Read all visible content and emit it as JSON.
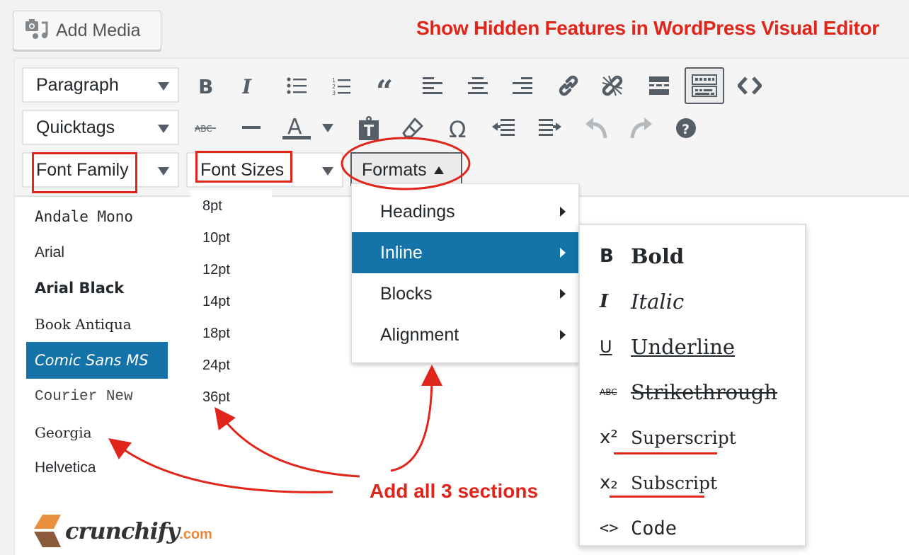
{
  "header": {
    "add_media_label": "Add Media",
    "headline": "Show Hidden Features in WordPress Visual Editor"
  },
  "toolbar": {
    "row1": {
      "select_label": "Paragraph",
      "icons": [
        "bold-icon",
        "italic-icon",
        "bullet-list-icon",
        "numbered-list-icon",
        "blockquote-icon",
        "align-left-icon",
        "align-center-icon",
        "align-right-icon",
        "link-icon",
        "unlink-icon",
        "read-more-icon",
        "toolbar-toggle-icon",
        "code-icon"
      ]
    },
    "row2": {
      "select_label": "Quicktags",
      "icons": [
        "strikethrough-icon",
        "horizontal-line-icon",
        "text-color-icon",
        "text-color-dropdown-icon",
        "paste-text-icon",
        "clear-formatting-icon",
        "special-character-icon",
        "outdent-icon",
        "indent-icon",
        "undo-icon",
        "redo-icon",
        "help-icon"
      ]
    },
    "row3": {
      "font_family_label": "Font Family",
      "font_sizes_label": "Font Sizes",
      "formats_label": "Formats"
    }
  },
  "font_family_list": {
    "items": [
      "Andale Mono",
      "Arial",
      "Arial Black",
      "Book Antiqua",
      "Comic Sans MS",
      "Courier New",
      "Georgia",
      "Helvetica"
    ],
    "selected": "Comic Sans MS"
  },
  "font_sizes_list": {
    "items": [
      "8pt",
      "10pt",
      "12pt",
      "14pt",
      "18pt",
      "24pt",
      "36pt"
    ]
  },
  "formats_menu": {
    "items": [
      "Headings",
      "Inline",
      "Blocks",
      "Alignment"
    ],
    "highlighted": "Inline"
  },
  "inline_submenu": {
    "items": [
      {
        "icon": "B",
        "label": "Bold"
      },
      {
        "icon": "I",
        "label": "Italic"
      },
      {
        "icon": "U",
        "label": "Underline"
      },
      {
        "icon": "ABC",
        "label": "Strikethrough"
      },
      {
        "icon": "x²",
        "label": "Superscript"
      },
      {
        "icon": "x₂",
        "label": "Subscript"
      },
      {
        "icon": "<>",
        "label": "Code"
      }
    ]
  },
  "annotation": {
    "text": "Add all 3 sections",
    "color": "#e0251b"
  },
  "logo": {
    "word": "crunchify",
    "domain": ".com"
  },
  "colors": {
    "accent": "#1474aa",
    "icon": "#555d66",
    "annotation": "#e0251b"
  }
}
